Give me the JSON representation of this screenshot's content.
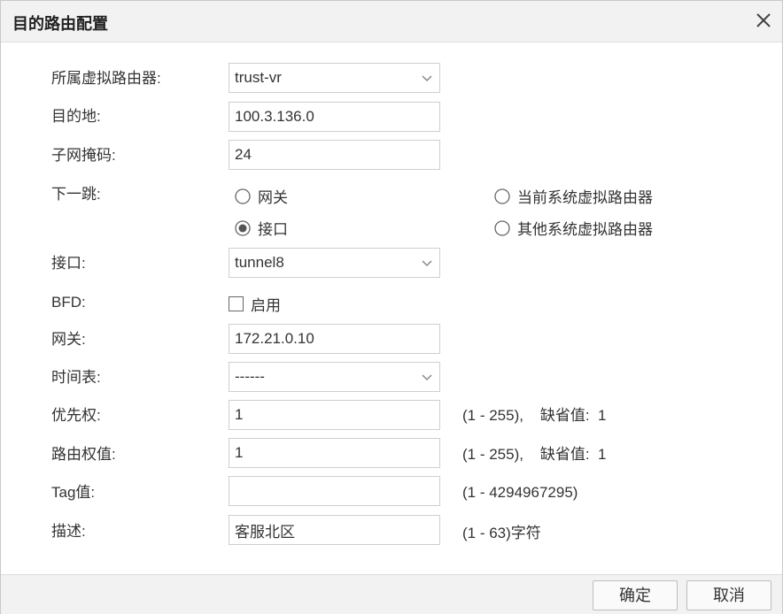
{
  "dialog": {
    "title": "目的路由配置",
    "close_icon": "close-icon"
  },
  "form": {
    "virtual_router": {
      "label": "所属虚拟路由器:",
      "value": "trust-vr"
    },
    "destination": {
      "label": "目的地:",
      "value": "100.3.136.0"
    },
    "subnet_mask": {
      "label": "子网掩码:",
      "value": "24"
    },
    "next_hop": {
      "label": "下一跳:",
      "options": {
        "gateway": {
          "label": "网关",
          "selected": false
        },
        "interface": {
          "label": "接口",
          "selected": true
        },
        "current_vr": {
          "label": "当前系统虚拟路由器",
          "selected": false
        },
        "other_vr": {
          "label": "其他系统虚拟路由器",
          "selected": false
        }
      }
    },
    "interface": {
      "label": "接口:",
      "value": "tunnel8"
    },
    "bfd": {
      "label": "BFD:",
      "checkbox_label": "启用",
      "checked": false
    },
    "gateway": {
      "label": "网关:",
      "value": "172.21.0.10"
    },
    "schedule": {
      "label": "时间表:",
      "value": "------"
    },
    "priority": {
      "label": "优先权:",
      "value": "1",
      "hint": "(1 - 255),    缺省值:  1"
    },
    "route_weight": {
      "label": "路由权值:",
      "value": "1",
      "hint": "(1 - 255),    缺省值:  1"
    },
    "tag": {
      "label": "Tag值:",
      "value": "",
      "hint": "(1 - 4294967295)"
    },
    "description": {
      "label": "描述:",
      "value": "客服北区",
      "hint": "(1 - 63)字符"
    }
  },
  "footer": {
    "ok_label": "确定",
    "cancel_label": "取消"
  },
  "colors": {
    "titlebar_bg": "#f2f2f2",
    "border": "#cfcfcf",
    "text": "#333333"
  }
}
